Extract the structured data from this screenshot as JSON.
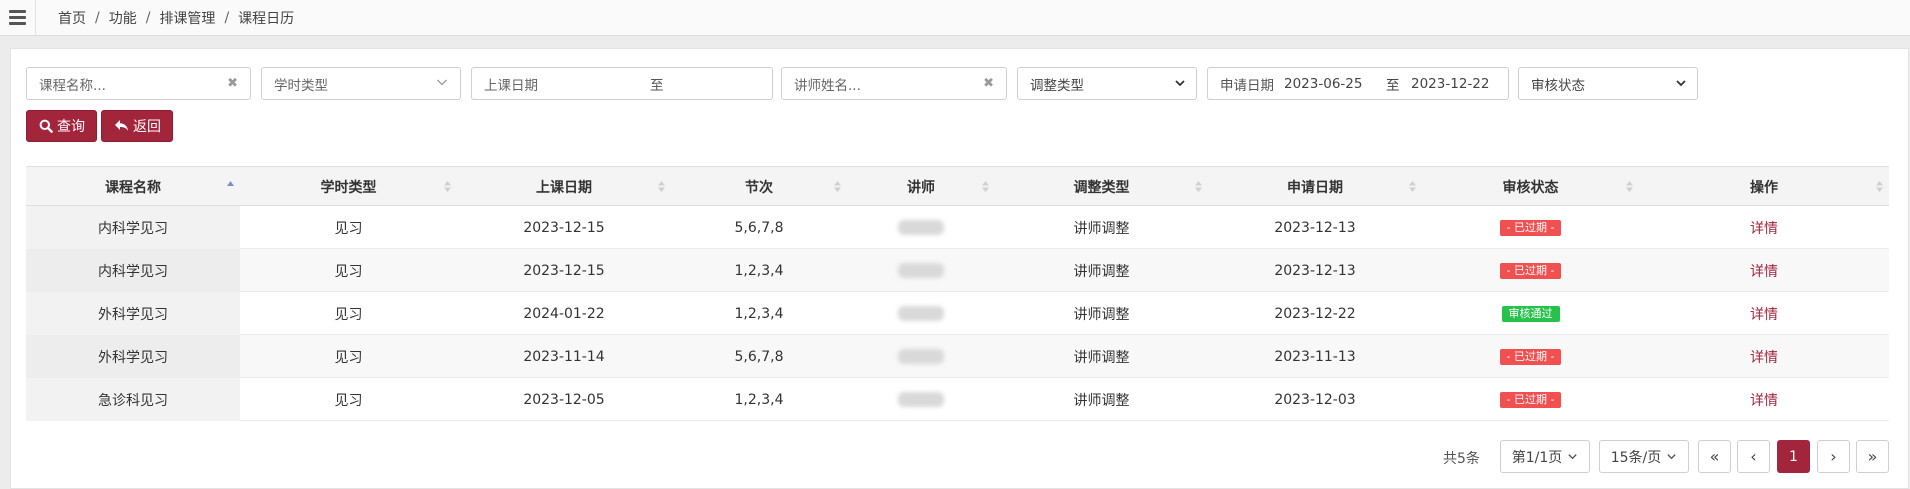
{
  "breadcrumb": [
    "首页",
    "功能",
    "排课管理",
    "课程日历"
  ],
  "filters": {
    "course_name_placeholder": "课程名称...",
    "hour_type_placeholder": "学时类型",
    "class_date_label": "上课日期",
    "range_sep": "至",
    "teacher_placeholder": "讲师姓名...",
    "adjust_type_selected": "调整类型",
    "apply_date_label": "申请日期",
    "apply_date_from": "2023-06-25",
    "apply_date_to": "2023-12-22",
    "review_status_selected": "审核状态",
    "clear_glyph": "✖"
  },
  "buttons": {
    "search": "查询",
    "back": "返回"
  },
  "table": {
    "headers": [
      "课程名称",
      "学时类型",
      "上课日期",
      "节次",
      "讲师",
      "调整类型",
      "申请日期",
      "审核状态",
      "操作"
    ],
    "rows": [
      {
        "course": "内科学见习",
        "type": "见习",
        "date": "2023-12-15",
        "sessions": "5,6,7,8",
        "adjust": "讲师调整",
        "apply": "2023-12-13",
        "status": "- 已过期 -",
        "status_kind": "expired",
        "action": "详情"
      },
      {
        "course": "内科学见习",
        "type": "见习",
        "date": "2023-12-15",
        "sessions": "1,2,3,4",
        "adjust": "讲师调整",
        "apply": "2023-12-13",
        "status": "- 已过期 -",
        "status_kind": "expired",
        "action": "详情"
      },
      {
        "course": "外科学见习",
        "type": "见习",
        "date": "2024-01-22",
        "sessions": "1,2,3,4",
        "adjust": "讲师调整",
        "apply": "2023-12-22",
        "status": "审核通过",
        "status_kind": "approved",
        "action": "详情"
      },
      {
        "course": "外科学见习",
        "type": "见习",
        "date": "2023-11-14",
        "sessions": "5,6,7,8",
        "adjust": "讲师调整",
        "apply": "2023-11-13",
        "status": "- 已过期 -",
        "status_kind": "expired",
        "action": "详情"
      },
      {
        "course": "急诊科见习",
        "type": "见习",
        "date": "2023-12-05",
        "sessions": "1,2,3,4",
        "adjust": "讲师调整",
        "apply": "2023-12-03",
        "status": "- 已过期 -",
        "status_kind": "expired",
        "action": "详情"
      }
    ]
  },
  "pagination": {
    "total": "共5条",
    "page_select": "第1/1页",
    "size_select": "15条/页",
    "first": "«",
    "prev": "‹",
    "current": "1",
    "next": "›",
    "last": "»"
  },
  "colors": {
    "accent": "#a3253c",
    "expired": "#f05050",
    "approved": "#27c24c"
  }
}
